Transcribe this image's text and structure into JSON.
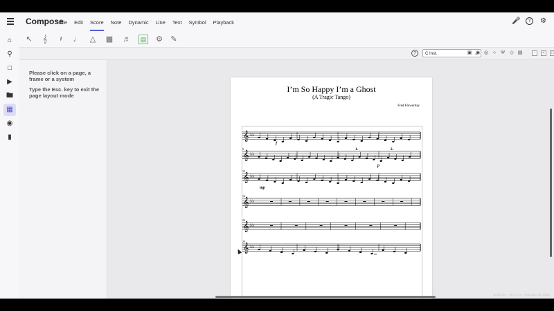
{
  "app": {
    "title": "Compose"
  },
  "menu": [
    "File",
    "Edit",
    "Score",
    "Note",
    "Dynamic",
    "Line",
    "Text",
    "Symbol",
    "Playback"
  ],
  "menu_active_index": 2,
  "colors": {
    "accent": "#5b5bd6",
    "active_tool": "#4caf50"
  },
  "top_right_icons": [
    "mic-icon",
    "help-icon",
    "settings-icon"
  ],
  "toolbar_icons": [
    "arrow-icon",
    "treble-clef-icon",
    "rest-icon",
    "note-icon",
    "metronome-icon",
    "keyboard-icon",
    "note-input-icon",
    "page-layout-icon",
    "gear-icon",
    "pen-icon"
  ],
  "rail_icons": [
    "home-icon",
    "search-icon",
    "library-icon",
    "play-icon",
    "folder-icon",
    "layout-icon",
    "view-icon",
    "exit-icon"
  ],
  "subbar": {
    "instrument_select": "C Inst.",
    "view_icons": [
      "square-stop-icon",
      "circle-icon",
      "circle-dot-icon",
      "circle-icon",
      "tuning-fork-icon",
      "diamond-icon",
      "piano-icon"
    ],
    "zoom_icons": [
      "minus-icon",
      "plus-icon",
      "fit-icon"
    ]
  },
  "panel": {
    "line1": "Please click on a page, a frame or a system",
    "line2": "Type the Esc. key to exit the page layout mode"
  },
  "score": {
    "title": "I’m So Happy I’m a Ghost",
    "subtitle": "(A Tragic Tango)",
    "composer": "Fred Flowerday",
    "measure_numbers": [
      "5",
      "10",
      "14",
      "22",
      "29"
    ],
    "dynamics": [
      "f",
      "p",
      "mp"
    ],
    "volta": [
      "1.",
      "2."
    ],
    "rit": "rit.",
    "watermark": "Build 225 · API 2.1.3 · February 28, 2023"
  }
}
